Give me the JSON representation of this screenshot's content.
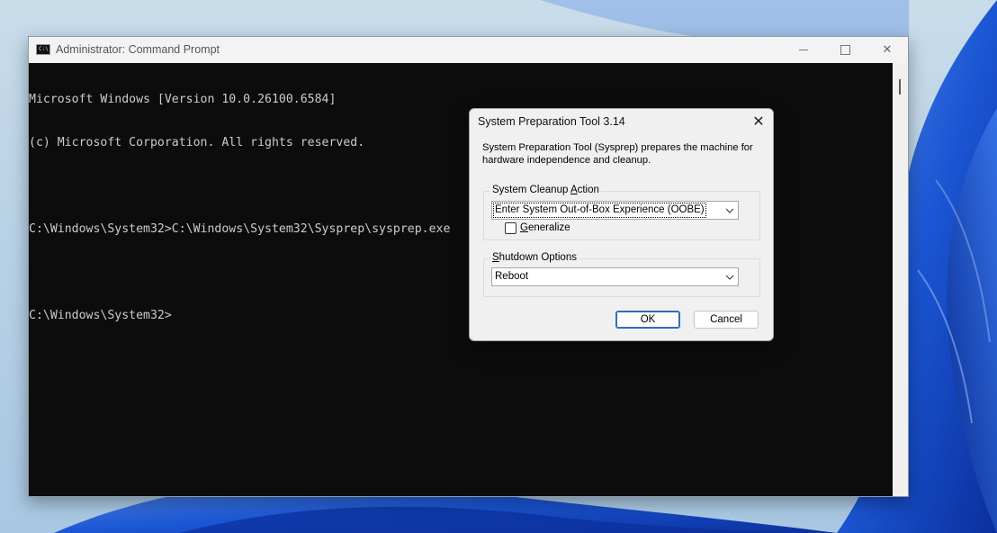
{
  "cmd_window": {
    "title": "Administrator: Command Prompt",
    "icon": "cmd-icon",
    "icon_text": "C:\\",
    "console_lines": [
      "Microsoft Windows [Version 10.0.26100.6584]",
      "(c) Microsoft Corporation. All rights reserved.",
      "",
      "C:\\Windows\\System32>C:\\Windows\\System32\\Sysprep\\sysprep.exe",
      "",
      "C:\\Windows\\System32>"
    ],
    "controls": {
      "minimize": "minimize-icon",
      "maximize": "maximize-icon",
      "close": "close-icon",
      "close_glyph": "✕"
    }
  },
  "sysprep_dialog": {
    "title": "System Preparation Tool 3.14",
    "close_glyph": "✕",
    "description": "System Preparation Tool (Sysprep) prepares the machine for hardware independence and cleanup.",
    "cleanup_group": {
      "label_pre": "System Cleanup ",
      "label_accel": "A",
      "label_post": "ction",
      "selected_value": "Enter System Out-of-Box Experience (OOBE)",
      "generalize_accel": "G",
      "generalize_rest": "eneralize",
      "generalize_checked": false
    },
    "shutdown_group": {
      "label_accel": "S",
      "label_post": "hutdown Options",
      "selected_value": "Reboot"
    },
    "ok_label": "OK",
    "cancel_label": "Cancel"
  },
  "colors": {
    "console_bg": "#0c0c0c",
    "console_text": "#cccccc",
    "accent": "#2f6bbf",
    "wallpaper_blue": "#1f5fd6"
  }
}
